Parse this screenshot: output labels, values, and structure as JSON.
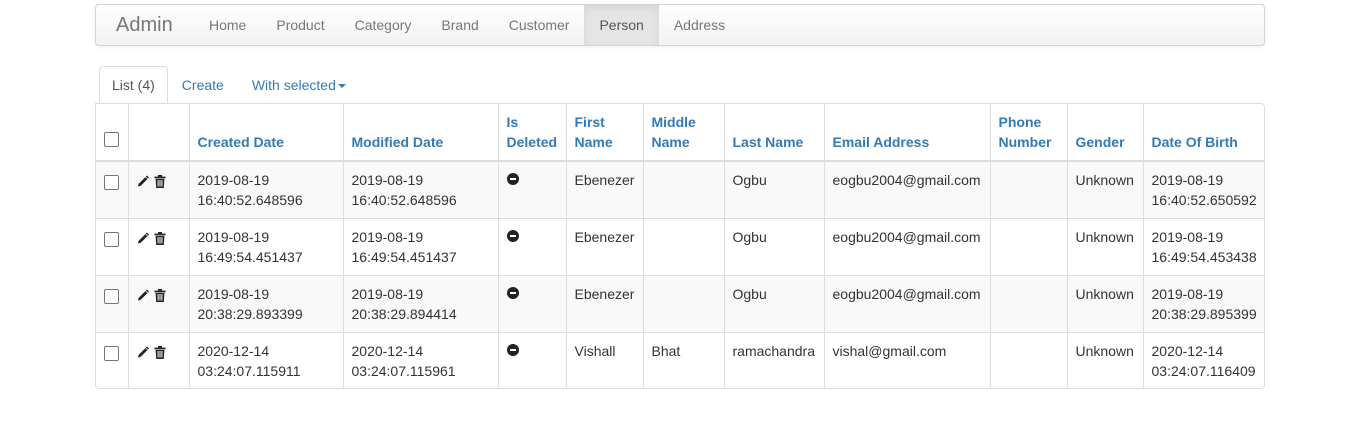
{
  "navbar": {
    "brand": "Admin",
    "items": [
      {
        "label": "Home"
      },
      {
        "label": "Product"
      },
      {
        "label": "Category"
      },
      {
        "label": "Brand"
      },
      {
        "label": "Customer"
      },
      {
        "label": "Person",
        "active": true
      },
      {
        "label": "Address"
      }
    ]
  },
  "tabs": {
    "list": "List (4)",
    "create": "Create",
    "with_selected": "With selected"
  },
  "table": {
    "columns": [
      "Created Date",
      "Modified Date",
      "Is Deleted",
      "First Name",
      "Middle Name",
      "Last Name",
      "Email Address",
      "Phone Number",
      "Gender",
      "Date Of Birth"
    ],
    "rows": [
      {
        "created": [
          "2019-08-19",
          "16:40:52.648596"
        ],
        "modified": [
          "2019-08-19",
          "16:40:52.648596"
        ],
        "first": "Ebenezer",
        "middle": "",
        "last": "Ogbu",
        "email": "eogbu2004@gmail.com",
        "phone": "",
        "gender": "Unknown",
        "dob": [
          "2019-08-19",
          "16:40:52.650592"
        ]
      },
      {
        "created": [
          "2019-08-19",
          "16:49:54.451437"
        ],
        "modified": [
          "2019-08-19",
          "16:49:54.451437"
        ],
        "first": "Ebenezer",
        "middle": "",
        "last": "Ogbu",
        "email": "eogbu2004@gmail.com",
        "phone": "",
        "gender": "Unknown",
        "dob": [
          "2019-08-19",
          "16:49:54.453438"
        ]
      },
      {
        "created": [
          "2019-08-19",
          "20:38:29.893399"
        ],
        "modified": [
          "2019-08-19",
          "20:38:29.894414"
        ],
        "first": "Ebenezer",
        "middle": "",
        "last": "Ogbu",
        "email": "eogbu2004@gmail.com",
        "phone": "",
        "gender": "Unknown",
        "dob": [
          "2019-08-19",
          "20:38:29.895399"
        ]
      },
      {
        "created": [
          "2020-12-14",
          "03:24:07.115911"
        ],
        "modified": [
          "2020-12-14",
          "03:24:07.115961"
        ],
        "first": "Vishall",
        "middle": "Bhat",
        "last": "ramachandra",
        "email": "vishal@gmail.com",
        "phone": "",
        "gender": "Unknown",
        "dob": [
          "2020-12-14",
          "03:24:07.116409"
        ]
      }
    ]
  },
  "icons": {
    "edit": "pencil-icon",
    "delete": "trash-icon",
    "is_deleted": "minus-circle-icon"
  },
  "colors": {
    "link": "#337ab7",
    "nav_active_bg": "#e5e5e5"
  }
}
